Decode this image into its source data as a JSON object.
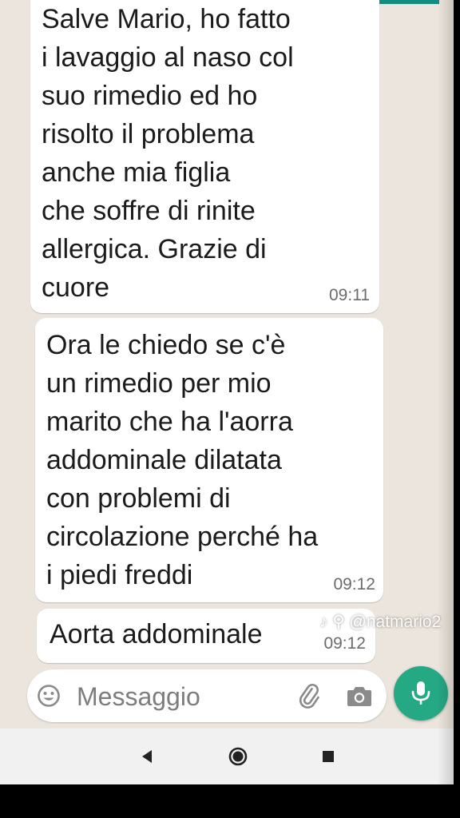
{
  "messages": [
    {
      "text": "Salve Mario, ho fatto\ni lavaggio al naso col\nsuo rimedio ed ho\nrisolto il problema\nanche mia figlia\nche soffre di rinite\nallergica.  Grazie di\ncuore",
      "time": "09:11"
    },
    {
      "text": "Ora le chiedo se c'è\nun rimedio per mio\nmarito che ha l'aorra\naddominale dilatata\ncon problemi di\ncircolazione perché ha\ni piedi freddi",
      "time": "09:12"
    },
    {
      "text": "Aorta addominale",
      "time": "09:12"
    }
  ],
  "watermark": "♪ ⚲ @natmario2",
  "input": {
    "placeholder": "Messaggio",
    "value": ""
  },
  "icons": {
    "emoji": "emoji-icon",
    "attach": "paperclip-icon",
    "camera": "camera-icon",
    "mic": "microphone-icon",
    "nav_back": "back-triangle-icon",
    "nav_home": "home-circle-icon",
    "nav_recents": "recents-square-icon"
  },
  "colors": {
    "chat_background": "#ece5dd",
    "bubble": "#ffffff",
    "accent": "#25a884",
    "header": "#128c7e"
  }
}
